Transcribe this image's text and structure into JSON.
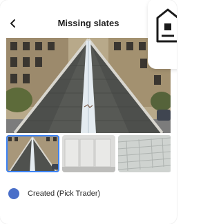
{
  "header": {
    "title": "Missing slates",
    "back_icon": "chevron-left-icon"
  },
  "gallery": {
    "thumbnails": [
      {
        "name": "roof-ridge-photo",
        "selected": true
      },
      {
        "name": "flat-roof-panels-photo",
        "selected": false
      },
      {
        "name": "slate-tiles-photo",
        "selected": false
      }
    ]
  },
  "status": {
    "label": "Created (Pick Trader)",
    "dot_color": "#4a6fc9"
  },
  "logo": {
    "icon": "house-logo-icon"
  },
  "colors": {
    "accent": "#3b82f6",
    "title": "#1f1f1f"
  }
}
